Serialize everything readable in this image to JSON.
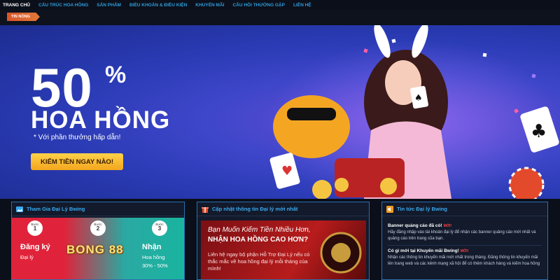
{
  "nav": {
    "items": [
      {
        "label": "TRANG CHỦ",
        "active": true
      },
      {
        "label": "CẤU TRÚC HOA HỒNG",
        "active": false
      },
      {
        "label": "SẢN PHẨM",
        "active": false
      },
      {
        "label": "ĐIỀU KHOẢN & ĐIỀU KIỆN",
        "active": false
      },
      {
        "label": "KHUYẾN MÃI",
        "active": false
      },
      {
        "label": "CÂU HỎI THƯỜNG GẶP",
        "active": false
      },
      {
        "label": "LIÊN HỆ",
        "active": false
      }
    ]
  },
  "ticker": {
    "hot_label": "TIN NÓNG"
  },
  "hero": {
    "big_number": "50",
    "percent": "%",
    "title": "HOA HỒNG",
    "subtitle": "* Với phần thưởng hấp dẫn!",
    "cta": "KIẾM TIỀN NGAY NÀO!"
  },
  "panels": {
    "join": {
      "title": "Tham Gia Đại Lý Bwing",
      "step1": {
        "label": "Bước",
        "num": "1",
        "text": "Đăng ký",
        "sub": "Đại lý"
      },
      "step2": {
        "label": "Bước",
        "num": "2"
      },
      "step3": {
        "label": "Bước",
        "num": "3",
        "text": "Nhận",
        "sub1": "Hoa hồng",
        "sub2": "30% - 50%"
      },
      "logo_text": "BONG 88"
    },
    "update": {
      "title": "Cập nhật thông tin Đại lý mới nhất",
      "promo_line1": "Bạn Muốn Kiếm Tiền Nhiều Hơn,",
      "promo_line2": "NHẬN HOA HỒNG CAO HƠN?",
      "promo_body": "Liên hệ ngay bộ phận Hỗ Trợ Đại Lý nếu có thắc mắc về hoa hồng đại lý mỗi tháng của mình!"
    },
    "news": {
      "title": "Tin tức Đại lý Bwing",
      "items": [
        {
          "title": "Banner quảng cáo đã có!",
          "badge": "MỚI!",
          "body": "Hãy đăng nhập vào tài khoản đại lý để nhận các banner quảng cáo mới nhất và quảng cáo trên trang của bạn."
        },
        {
          "title": "Có gì mới tại Khuyến mãi Bwing!",
          "badge": "MỚI!",
          "body": "Nhận các thông tin khuyến mãi mới nhất trong tháng. Đăng thông tin khuyến mãi lên trang web và các kênh mạng xã hội để có thêm khách hàng và kiếm hoa hồng"
        }
      ]
    }
  }
}
